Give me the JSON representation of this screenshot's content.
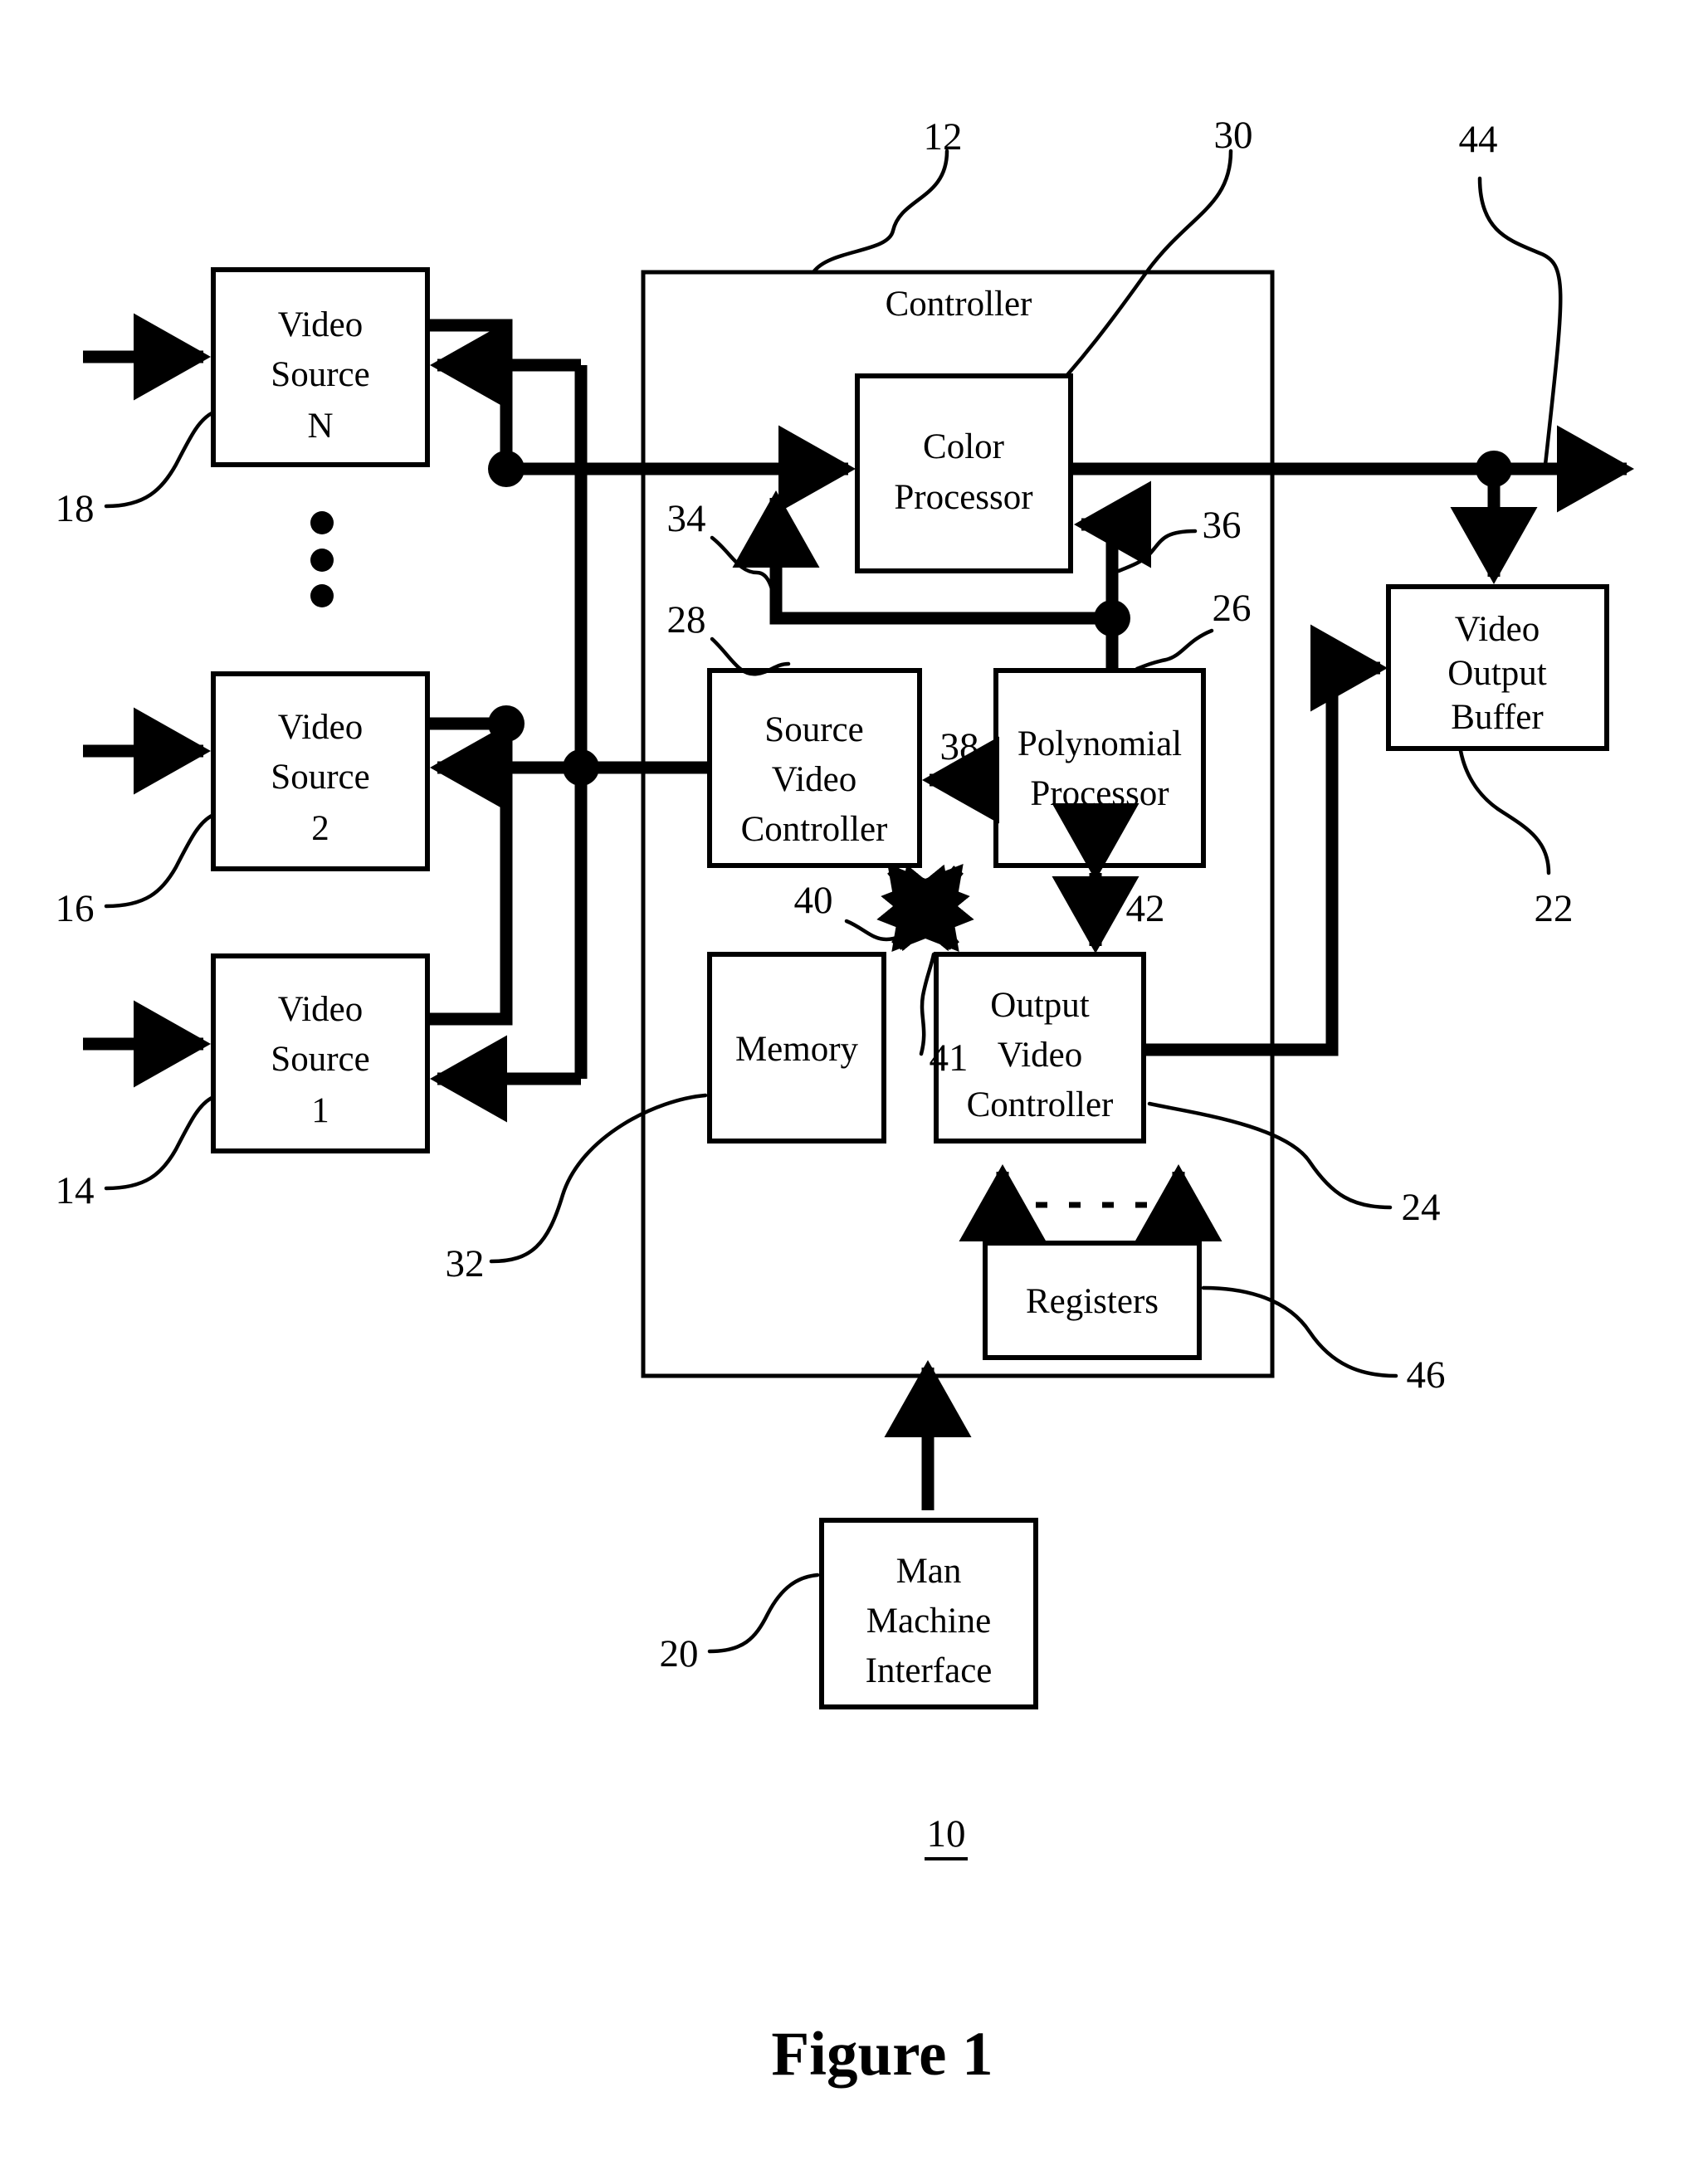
{
  "figure": {
    "caption": "Figure  1",
    "system_number": "10"
  },
  "controller": {
    "title": "Controller",
    "ref": "12"
  },
  "blocks": {
    "video_source_n": {
      "lines": [
        "Video",
        "Source",
        "N"
      ],
      "ref": "18"
    },
    "video_source_2": {
      "lines": [
        "Video",
        "Source",
        "2"
      ],
      "ref": "16"
    },
    "video_source_1": {
      "lines": [
        "Video",
        "Source",
        "1"
      ],
      "ref": "14"
    },
    "color_processor": {
      "lines": [
        "Color",
        "Processor"
      ],
      "ref": "30"
    },
    "polynomial_processor": {
      "lines": [
        "Polynomial",
        "Processor"
      ],
      "ref": "26"
    },
    "source_video_controller": {
      "lines": [
        "Source",
        "Video",
        "Controller"
      ],
      "ref": "28"
    },
    "memory": {
      "lines": [
        "Memory"
      ],
      "ref": "32"
    },
    "output_video_controller": {
      "lines": [
        "Output",
        "Video",
        "Controller"
      ],
      "ref": "24"
    },
    "registers": {
      "lines": [
        "Registers"
      ],
      "ref": "46"
    },
    "video_output_buffer": {
      "lines": [
        "Video",
        "Output",
        "Buffer"
      ],
      "ref": "22"
    },
    "man_machine_interface": {
      "lines": [
        "Man",
        "Machine",
        "Interface"
      ],
      "ref": "20"
    }
  },
  "signal_refs": {
    "color_processor_input_34": "34",
    "color_processor_control_36": "36",
    "polynomial_to_source_video_38": "38",
    "memory_crossbar_40": "40",
    "memory_crossbar_41": "41",
    "polynomial_output_video_42": "42",
    "system_output_44": "44"
  },
  "colors": {
    "ink": "#000000",
    "paper": "#ffffff"
  }
}
